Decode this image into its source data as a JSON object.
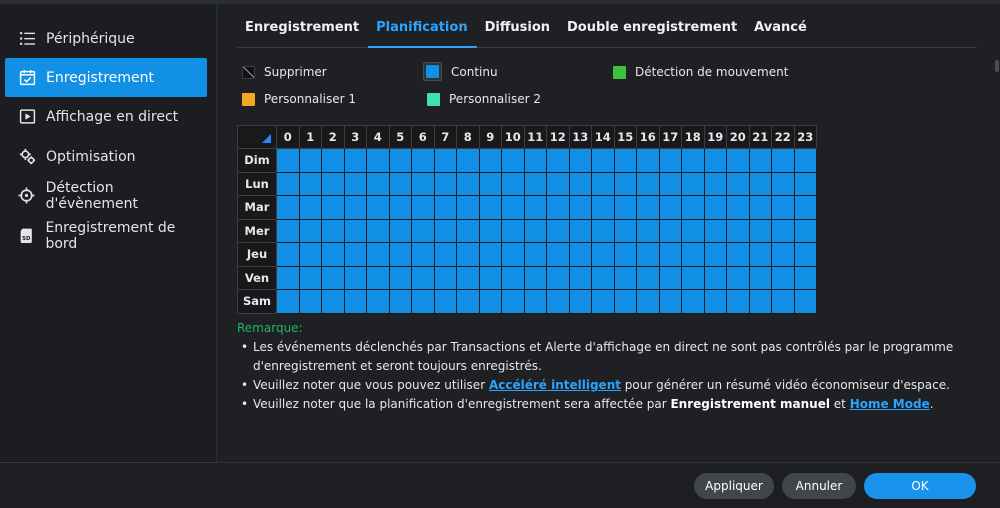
{
  "sidebar": {
    "items": [
      {
        "label": "Périphérique",
        "icon": "list-icon"
      },
      {
        "label": "Enregistrement",
        "icon": "calendar-check-icon",
        "active": true
      },
      {
        "label": "Affichage en direct",
        "icon": "play-square-icon"
      },
      {
        "label": "Optimisation",
        "icon": "gears-icon"
      },
      {
        "label": "Détection d'évènement",
        "icon": "crosshair-icon"
      },
      {
        "label": "Enregistrement de bord",
        "icon": "sd-card-icon"
      }
    ]
  },
  "tabs": [
    {
      "label": "Enregistrement"
    },
    {
      "label": "Planification",
      "active": true
    },
    {
      "label": "Diffusion"
    },
    {
      "label": "Double enregistrement"
    },
    {
      "label": "Avancé"
    }
  ],
  "legend": {
    "delete": {
      "label": "Supprimer",
      "color": "#111214"
    },
    "continuous": {
      "label": "Continu",
      "color": "#1190e6"
    },
    "motion": {
      "label": "Détection de mouvement",
      "color": "#3cc23c"
    },
    "custom1": {
      "label": "Personnaliser 1",
      "color": "#f5a623"
    },
    "custom2": {
      "label": "Personnaliser 2",
      "color": "#3ee0b0"
    }
  },
  "schedule": {
    "hours": [
      "0",
      "1",
      "2",
      "3",
      "4",
      "5",
      "6",
      "7",
      "8",
      "9",
      "10",
      "11",
      "12",
      "13",
      "14",
      "15",
      "16",
      "17",
      "18",
      "19",
      "20",
      "21",
      "22",
      "23"
    ],
    "days": [
      "Dim",
      "Lun",
      "Mar",
      "Mer",
      "Jeu",
      "Ven",
      "Sam"
    ],
    "fill_mode": "continuous"
  },
  "notes": {
    "title": "Remarque:",
    "item1": "Les événements déclenchés par Transactions et Alerte d'affichage en direct ne sont pas contrôlés par le programme d'enregistrement et seront toujours enregistrés.",
    "item2_pre": "Veuillez noter que vous pouvez utiliser ",
    "item2_link": "Accéléré intelligent",
    "item2_post": " pour générer un résumé vidéo économiseur d'espace.",
    "item3_pre": "Veuillez noter que la planification d'enregistrement sera affectée par ",
    "item3_bold": "Enregistrement manuel",
    "item3_mid": " et ",
    "item3_link": "Home Mode",
    "item3_post": "."
  },
  "footer": {
    "apply": "Appliquer",
    "cancel": "Annuler",
    "ok": "OK"
  },
  "colors": {
    "accent": "#1190e6",
    "note_title": "#22b366",
    "link": "#2aa4ff"
  }
}
